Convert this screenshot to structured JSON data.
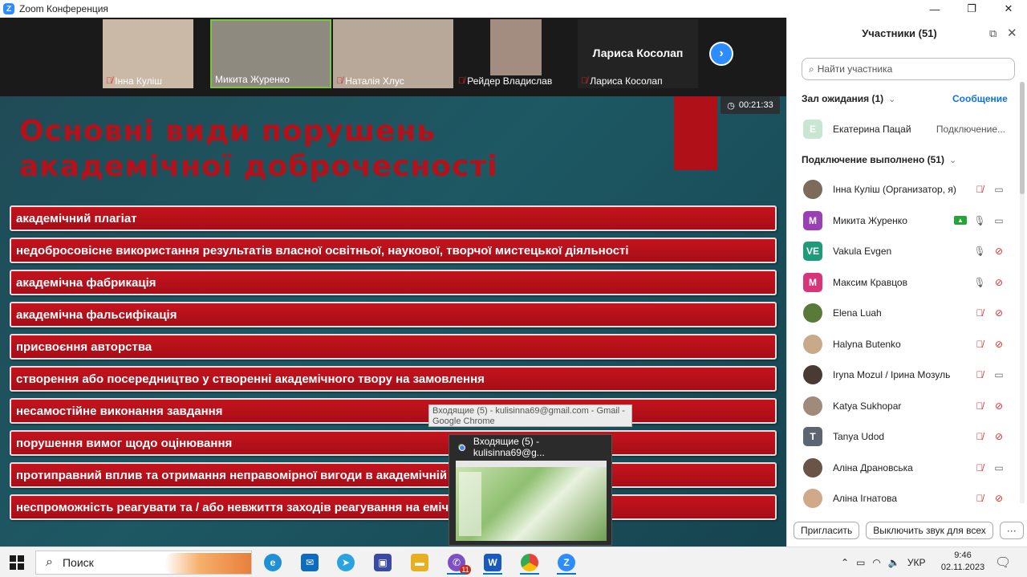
{
  "window": {
    "title": "Zoom Конференция",
    "controls": [
      "—",
      "❐",
      "✕"
    ]
  },
  "gallery": {
    "thumbnails": [
      {
        "name": "Інна Куліш",
        "muted": true,
        "bg": "#c9b9a6"
      },
      {
        "name": "Микита Журенко",
        "muted": false,
        "bg": "#8f8a80"
      },
      {
        "name": "Наталія Хлус",
        "muted": true,
        "bg": "#b8a89a"
      },
      {
        "name": "Рейдер Владислав",
        "muted": true,
        "bg": "#a38d80"
      },
      {
        "name": "Лариса Косолап",
        "muted": true,
        "bg": "#232323",
        "big_name": "Лариса Косолап"
      }
    ]
  },
  "slide": {
    "timer": "00:21:33",
    "title_line1": "Основні види порушень",
    "title_line2": "академічної доброчесності",
    "items": [
      "академічний плагіат",
      "недобросовісне використання результатів власної освітньої, наукової, творчої мистецької діяльності",
      "академічна фабрикація",
      "академічна фальсифікація",
      "присвоєння авторства",
      "створення або посередництво у створенні академічного твору на замовлення",
      "несамостійне виконання завдання",
      "порушення вимог щодо оцінювання",
      "протиправний вплив та отримання неправомірної вигоди в академічній",
      "неспроможність реагувати та / або невжиття заходів реагування на                                                           емічної доброчесності"
    ]
  },
  "tooltip": {
    "line1": "Входящие (5) - kulisinna69@gmail.com - Gmail -",
    "line2": "Google Chrome"
  },
  "preview": {
    "title": "Входящие (5) - kulisinna69@g..."
  },
  "panel": {
    "title": "Участники (51)",
    "search_placeholder": "Найти участника",
    "waiting_room_label": "Зал ожидания (1)",
    "message_label": "Сообщение",
    "waiting": {
      "initial": "E",
      "name": "Екатерина Пацай",
      "status": "Подключение...",
      "color": "#c9e6d3"
    },
    "connected_label": "Подключение выполнено (51)",
    "participants": [
      {
        "name": "Інна Куліш (Организатор, я)",
        "initial": "",
        "color": "#7c6a5a",
        "mic": "off",
        "video": "on",
        "share": false
      },
      {
        "name": "Микита Журенко",
        "initial": "M",
        "color": "#9b3fb7",
        "mic": "on",
        "video": "on",
        "share": true
      },
      {
        "name": "Vakula Evgen",
        "initial": "VE",
        "color": "#1e9c7a",
        "mic": "on",
        "video": "off",
        "share": false
      },
      {
        "name": "Максим Кравцов",
        "initial": "M",
        "color": "#d8347a",
        "mic": "on",
        "video": "off",
        "share": false
      },
      {
        "name": "Elena Luah",
        "initial": "",
        "color": "#5a7a3a",
        "mic": "off",
        "video": "off",
        "share": false
      },
      {
        "name": "Halyna Butenko",
        "initial": "",
        "color": "#c8a98a",
        "mic": "off",
        "video": "off",
        "share": false
      },
      {
        "name": "Iryna Mozul / Ірина Мозуль",
        "initial": "",
        "color": "#4a3a34",
        "mic": "off",
        "video": "on",
        "share": false
      },
      {
        "name": "Katya Sukhopar",
        "initial": "",
        "color": "#a08a7a",
        "mic": "off",
        "video": "off",
        "share": false
      },
      {
        "name": "Tanya Udod",
        "initial": "T",
        "color": "#5b6670",
        "mic": "off",
        "video": "off",
        "share": false
      },
      {
        "name": "Аліна Драновська",
        "initial": "",
        "color": "#6a5448",
        "mic": "off",
        "video": "on",
        "share": false
      },
      {
        "name": "Аліна Ігнатова",
        "initial": "",
        "color": "#d0a88a",
        "mic": "off",
        "video": "off",
        "share": false
      }
    ],
    "invite_label": "Пригласить",
    "mute_all_label": "Выключить звук для всех",
    "more_label": "···"
  },
  "taskbar": {
    "search_label": "Поиск",
    "apps": [
      {
        "name": "edge",
        "glyph": "e",
        "color": "#1f8fd6"
      },
      {
        "name": "mail",
        "glyph": "✉",
        "color": "#0f6cbd"
      },
      {
        "name": "telegram",
        "glyph": "➤",
        "color": "#2aa3e0"
      },
      {
        "name": "save",
        "glyph": "▣",
        "color": "#3a4aa0"
      },
      {
        "name": "explorer",
        "glyph": "▬",
        "color": "#e8b020"
      },
      {
        "name": "viber",
        "glyph": "✆",
        "color": "#7d4fc4",
        "badge": "11"
      },
      {
        "name": "word",
        "glyph": "W",
        "color": "#185abd"
      },
      {
        "name": "chrome",
        "glyph": "",
        "color": "#4285f4"
      },
      {
        "name": "zoom",
        "glyph": "Z",
        "color": "#2d8cff"
      }
    ],
    "lang": "УКР",
    "time": "9:46",
    "date": "02.11.2023"
  }
}
